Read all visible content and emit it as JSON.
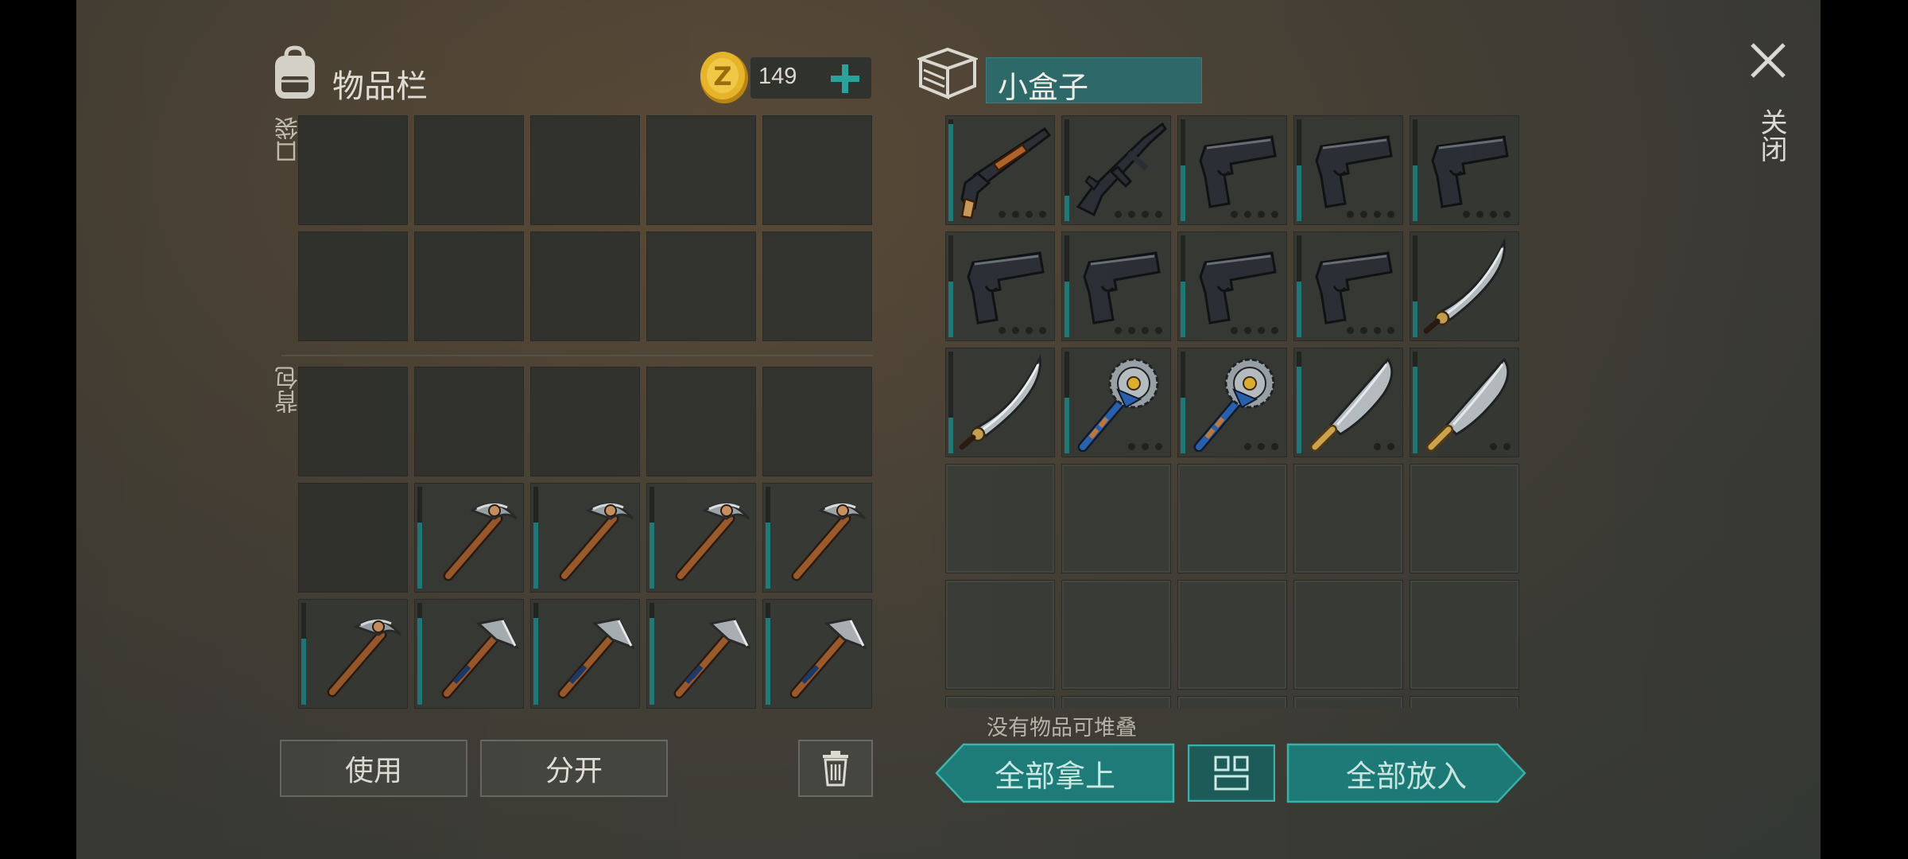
{
  "inventory": {
    "title": "物品栏",
    "coins": "149",
    "pocket_label": "口袋",
    "backpack_label": "背包",
    "use_label": "使用",
    "split_label": "分开",
    "pocket_slots": [
      "",
      "",
      "",
      "",
      "",
      "",
      "",
      "",
      "",
      ""
    ],
    "backpack_slots": [
      "",
      "",
      "",
      "",
      "",
      "",
      "pickaxe",
      "pickaxe",
      "pickaxe",
      "pickaxe",
      "pickaxe",
      "hatchet",
      "hatchet",
      "hatchet",
      "hatchet"
    ]
  },
  "container": {
    "title": "小盒子",
    "no_stack_text": "没有物品可堆叠",
    "take_all_label": "全部拿上",
    "put_all_label": "全部放入",
    "slots": [
      "shotgun",
      "rifle",
      "pistol",
      "pistol",
      "pistol",
      "pistol",
      "pistol",
      "pistol",
      "pistol",
      "sword",
      "sword",
      "saw-mace",
      "saw-mace",
      "machete",
      "machete",
      "",
      "",
      "",
      "",
      "",
      "",
      "",
      "",
      "",
      "",
      "",
      "",
      "",
      "",
      ""
    ]
  },
  "header": {
    "close_label": "关闭"
  },
  "colors": {
    "accent": "#1f8a86",
    "slot": "#32332f",
    "panel_bg": "#4a4236"
  }
}
